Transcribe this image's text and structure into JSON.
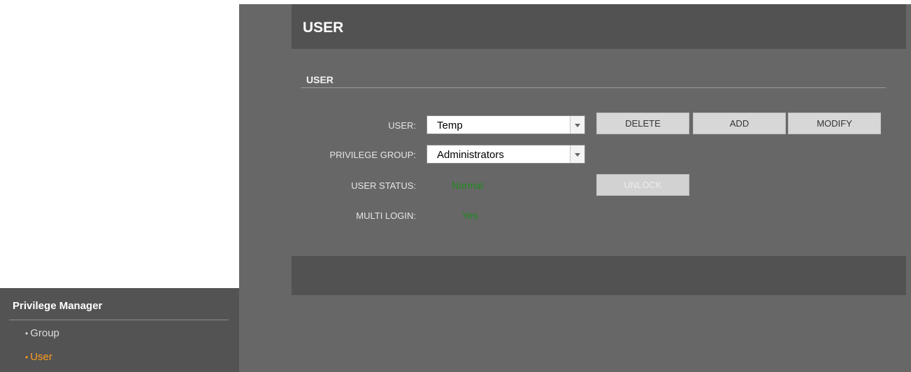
{
  "header": {
    "title": "USER"
  },
  "section": {
    "title": "USER"
  },
  "form": {
    "user_label": "USER:",
    "user_value": "Temp",
    "group_label": "PRIVILEGE GROUP:",
    "group_value": "Administrators",
    "status_label": "USER STATUS:",
    "status_value": "Normal",
    "multi_login_label": "MULTI LOGIN:",
    "multi_login_value": "Yes"
  },
  "buttons": {
    "delete": "DELETE",
    "add": "ADD",
    "modify": "MODIFY",
    "unlock": "UNLOCK"
  },
  "sidebar": {
    "title": "Privilege Manager",
    "items": [
      {
        "label": "Group",
        "active": false
      },
      {
        "label": "User",
        "active": true
      }
    ]
  },
  "colors": {
    "accent_active": "#ff9a1e",
    "status_ok": "#1e8a1e",
    "panel_dark": "#525252",
    "panel_mid": "#676767"
  },
  "icons": {
    "dropdown": "chevron-down-icon",
    "bullet": "bullet-dot"
  }
}
